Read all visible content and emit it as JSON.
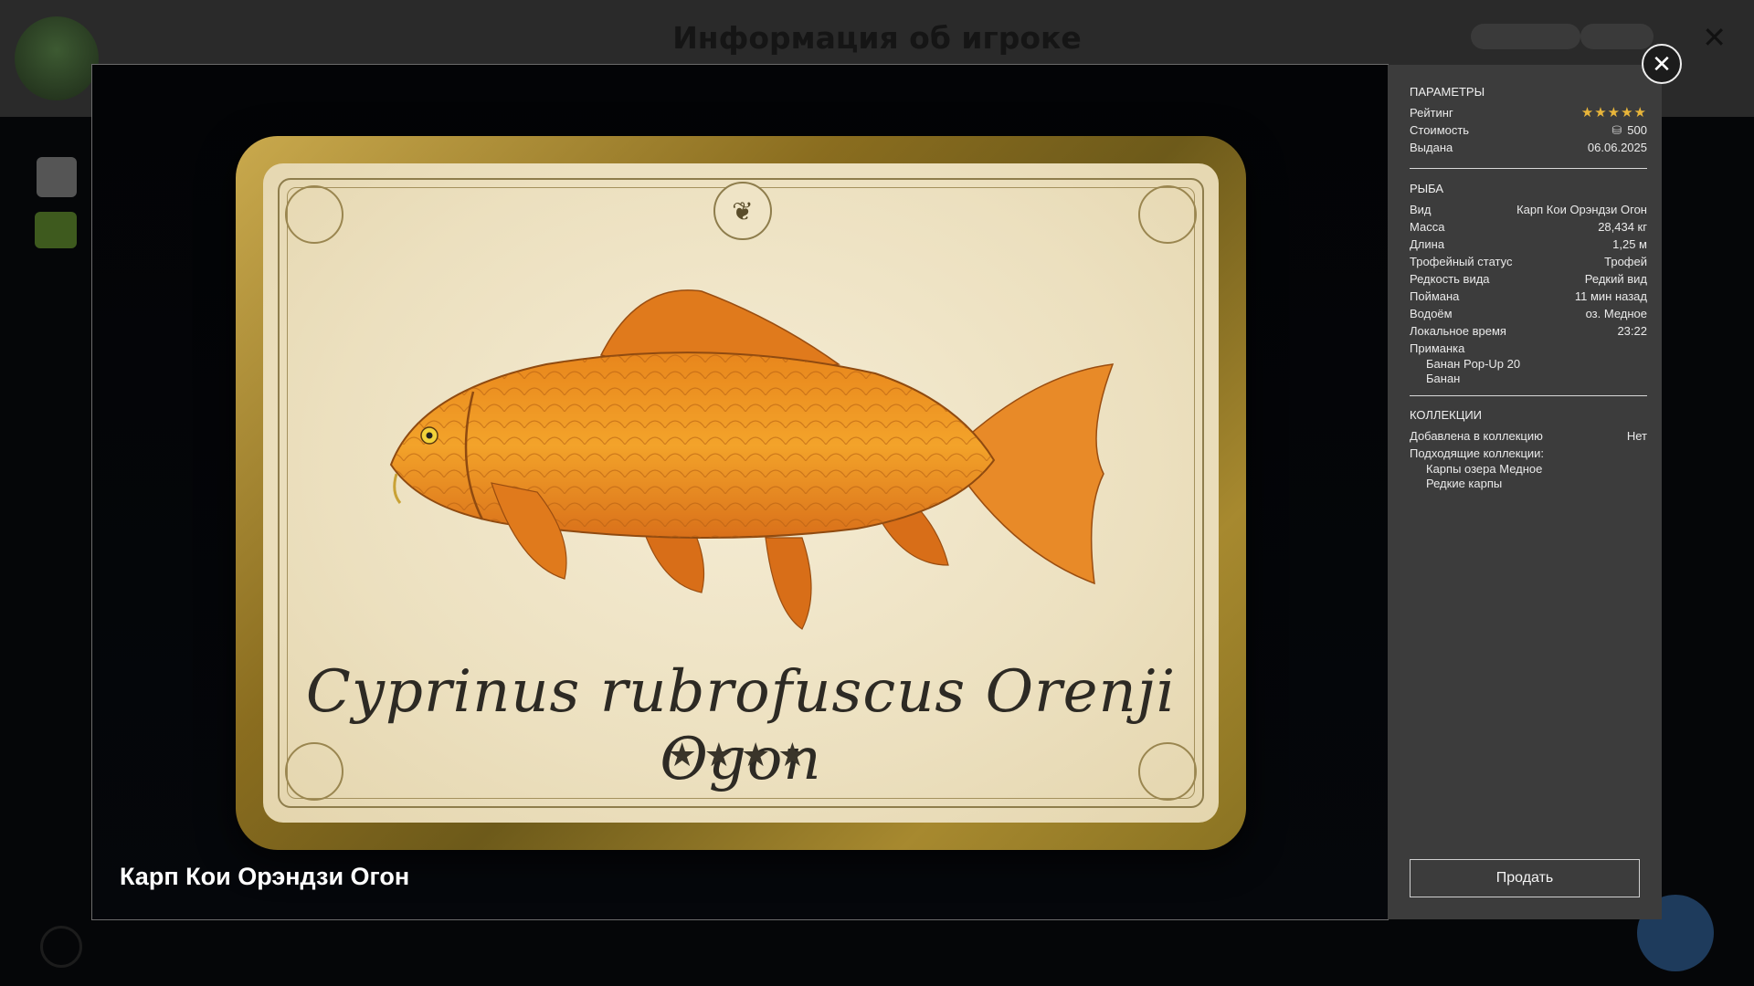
{
  "background": {
    "title": "Информация об игроке",
    "username": "",
    "currency_1": "",
    "currency_2": ""
  },
  "card": {
    "latin_name": "Cyprinus rubrofuscus Orenji Ogon",
    "stars": "★★★★"
  },
  "fish_name": "Карп Кои Орэндзи Огон",
  "panel": {
    "params": {
      "title": "ПАРАМЕТРЫ",
      "rating_label": "Рейтинг",
      "rating_stars": "★★★★★",
      "cost_label": "Стоимость",
      "cost_value": "500",
      "issued_label": "Выдана",
      "issued_value": "06.06.2025"
    },
    "fish": {
      "title": "РЫБА",
      "rows": [
        {
          "label": "Вид",
          "value": "Карп Кои Орэндзи Огон"
        },
        {
          "label": "Масса",
          "value": "28,434 кг"
        },
        {
          "label": "Длина",
          "value": "1,25 м"
        },
        {
          "label": "Трофейный статус",
          "value": "Трофей"
        },
        {
          "label": "Редкость вида",
          "value": "Редкий вид"
        },
        {
          "label": "Поймана",
          "value": "11 мин назад"
        },
        {
          "label": "Водоём",
          "value": "оз. Медное"
        },
        {
          "label": "Локальное время",
          "value": "23:22"
        }
      ],
      "bait_label": "Приманка",
      "bait_items": [
        "Банан Pop-Up 20",
        "Банан"
      ]
    },
    "collections": {
      "title": "КОЛЛЕКЦИИ",
      "added_label": "Добавлена в коллекцию",
      "added_value": "Нет",
      "suitable_label": "Подходящие коллекции:",
      "suitable_items": [
        "Карпы озера Медное",
        "Редкие карпы"
      ]
    },
    "sell_label": "Продать"
  },
  "close_label": "✕"
}
